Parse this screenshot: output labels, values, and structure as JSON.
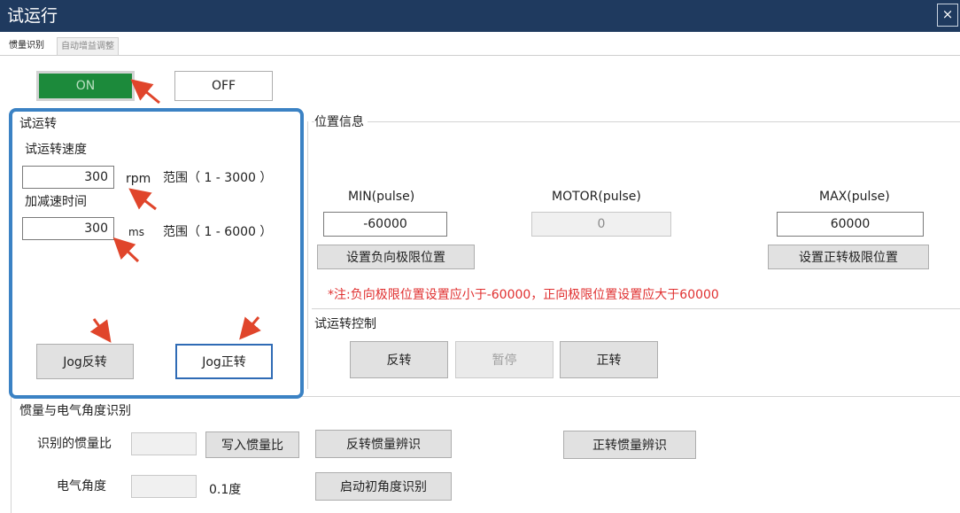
{
  "window": {
    "title": "试运行",
    "close": "×"
  },
  "tabs": [
    {
      "label": "惯量识别",
      "active": true
    },
    {
      "label": "自动增益调整",
      "active": false
    }
  ],
  "power": {
    "on_label": "ON",
    "off_label": "OFF",
    "on_color": "#1c8a3b"
  },
  "trial_run": {
    "title": "试运转",
    "speed_label": "试运转速度",
    "speed_value": "300",
    "speed_unit": "rpm",
    "speed_range": "范围（ 1 - 3000 ）",
    "accel_label": "加减速时间",
    "accel_value": "300",
    "accel_unit": "ms",
    "accel_range": "范围（ 1 - 6000 ）",
    "jog_reverse": "Jog反转",
    "jog_forward": "Jog正转"
  },
  "position": {
    "title": "位置信息",
    "min_label": "MIN(pulse)",
    "min_value": "-60000",
    "motor_label": "MOTOR(pulse)",
    "motor_value": "0",
    "max_label": "MAX(pulse)",
    "max_value": "60000",
    "set_negative": "设置负向极限位置",
    "set_positive": "设置正转极限位置",
    "note": "*注:负向极限位置设置应小于-60000，正向极限位置设置应大于60000"
  },
  "run_control": {
    "title": "试运转控制",
    "reverse": "反转",
    "pause": "暂停",
    "forward": "正转"
  },
  "inertia": {
    "title": "惯量与电气角度识别",
    "ratio_label": "识别的惯量比",
    "ratio_value": "",
    "write_button": "写入惯量比",
    "reverse_identify": "反转惯量辨识",
    "forward_identify": "正转惯量辨识",
    "angle_label": "电气角度",
    "angle_value": "",
    "angle_unit": "0.1度",
    "start_angle": "启动初角度识别"
  },
  "colors": {
    "titlebar": "#1f3a5f",
    "highlight": "#3b82c4",
    "arrow": "#e0452b",
    "note": "#e03030"
  }
}
